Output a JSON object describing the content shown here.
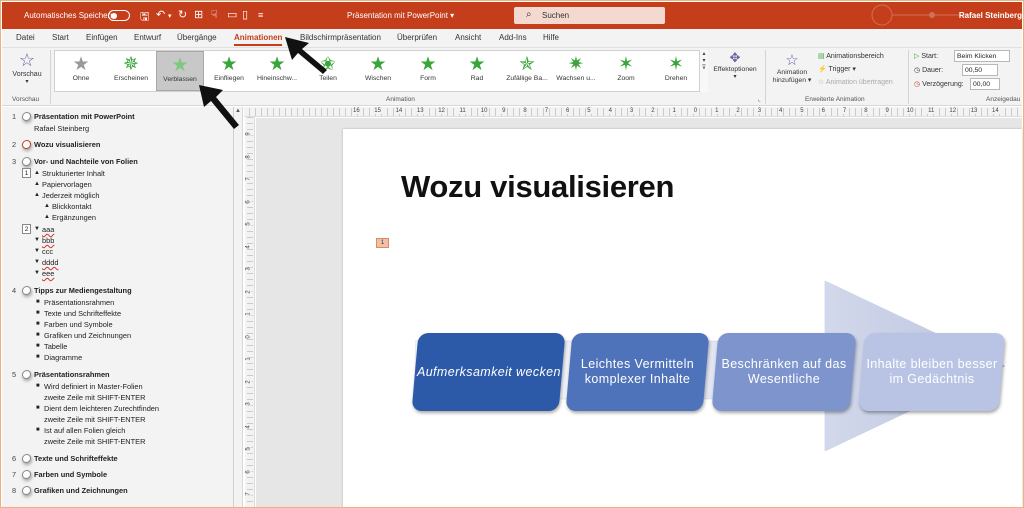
{
  "titlebar": {
    "autosave_label": "Automatisches Speichern",
    "doc_title": "Präsentation mit PowerPoint ▾",
    "search_placeholder": "Suchen",
    "user": "Rafael Steinberg"
  },
  "menu": [
    "Datei",
    "Start",
    "Einfügen",
    "Entwurf",
    "Übergänge",
    "Animationen",
    "Bildschirmpräsentation",
    "Überprüfen",
    "Ansicht",
    "Add-Ins",
    "Hilfe"
  ],
  "menu_active": "Animationen",
  "ribbon": {
    "preview_label": "Vorschau",
    "preview_group": "Vorschau",
    "animation_group": "Animation",
    "advanced_group": "Erweiterte Animation",
    "timing_group": "Anzeigedau",
    "gallery": [
      "Ohne",
      "Erscheinen",
      "Verblassen",
      "Einfliegen",
      "Hineinschw...",
      "Teilen",
      "Wischen",
      "Form",
      "Rad",
      "Zufällige Ba...",
      "Wachsen u...",
      "Zoom",
      "Drehen"
    ],
    "gallery_selected": "Verblassen",
    "effect_options": "Effektoptionen",
    "add_animation_line1": "Animation",
    "add_animation_line2": "hinzufügen ▾",
    "animation_pane": "Animationsbereich",
    "trigger": "Trigger ▾",
    "copy_animation": "Animation übertragen",
    "start_label": "Start:",
    "start_value": "Beim Klicken",
    "duration_label": "Dauer:",
    "duration_value": "00,50",
    "delay_label": "Verzögerung:",
    "delay_value": "00,00"
  },
  "outline": {
    "slide1_title": "Präsentation mit PowerPoint",
    "slide1_sub": "Rafael Steinberg",
    "slide2_title": "Wozu visualisieren",
    "slide3_title": "Vor- und Nachteile von Folien",
    "s3_a": "Strukturierter Inhalt",
    "s3_b": "Papiervorlagen",
    "s3_c": "Jederzeit möglich",
    "s3_d": "Blickkontakt",
    "s3_e": "Ergänzungen",
    "s3_f": "aaa",
    "s3_g": "bbb",
    "s3_h": "ccc",
    "s3_i": "dddd",
    "s3_j": "eee",
    "slide4_title": "Tipps zur Mediengestaltung",
    "s4_a": "Präsentationsrahmen",
    "s4_b": "Texte und Schrifteffekte",
    "s4_c": "Farben und Symbole",
    "s4_d": "Grafiken und Zeichnungen",
    "s4_e": "Tabelle",
    "s4_f": "Diagramme",
    "slide5_title": "Präsentationsrahmen",
    "s5_a1": "Wird definiert in Master-Folien",
    "s5_a2": "zweite Zeile mit SHIFT-ENTER",
    "s5_b1": "Dient dem leichteren Zurechtfinden",
    "s5_b2": "zweite Zeile mit SHIFT-ENTER",
    "s5_c1": "Ist auf allen Folien gleich",
    "s5_c2": "zweite Zeile mit SHIFT-ENTER",
    "slide6_title": "Texte und Schrifteffekte",
    "slide7_title": "Farben und Symbole",
    "slide8_title": "Grafiken und Zeichnungen",
    "nums": [
      "1",
      "2",
      "3",
      "4",
      "5",
      "6",
      "7",
      "8"
    ],
    "sub_nums": [
      "1",
      "2"
    ]
  },
  "ruler": {
    "h_labels": [
      "16",
      "15",
      "14",
      "13",
      "12",
      "11",
      "10",
      "9",
      "8",
      "7",
      "6",
      "5",
      "4",
      "3",
      "2",
      "1",
      "0",
      "1",
      "2",
      "3",
      "4",
      "5",
      "6",
      "7",
      "8",
      "9",
      "10",
      "11",
      "12",
      "13",
      "14"
    ],
    "v_labels": [
      "9",
      "8",
      "7",
      "6",
      "5",
      "4",
      "3",
      "2",
      "1",
      "0",
      "1",
      "2",
      "3",
      "4",
      "5",
      "6",
      "7"
    ]
  },
  "slide": {
    "title": "Wozu visualisieren",
    "anim_tag": "1",
    "box1": "Aufmerksamkeit wecken",
    "box2": "Leichtes Vermitteln komplexer Inhalte",
    "box3": "Beschränken auf das Wesentliche",
    "box4": "Inhalte bleiben besser im Gedächtnis"
  },
  "colors": {
    "accent": "#c43e1c",
    "box1": "#2d5aa8",
    "box2": "#4e73bb",
    "box3": "#7d94cd",
    "box4": "#b9c4e4"
  }
}
